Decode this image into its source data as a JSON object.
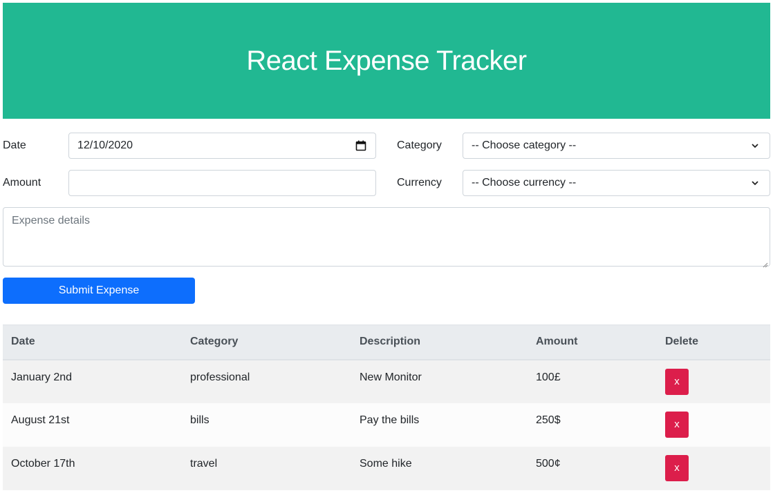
{
  "header": {
    "title": "React Expense Tracker"
  },
  "form": {
    "date_label": "Date",
    "date_value": "12/10/2020",
    "amount_label": "Amount",
    "amount_value": "",
    "category_label": "Category",
    "category_selected": "-- Choose category --",
    "currency_label": "Currency",
    "currency_selected": "-- Choose currency --",
    "details_placeholder": "Expense details",
    "submit_label": "Submit Expense"
  },
  "table": {
    "headers": [
      "Date",
      "Category",
      "Description",
      "Amount",
      "Delete"
    ],
    "rows": [
      {
        "date": "January 2nd",
        "category": "professional",
        "description": "New Monitor",
        "amount": "100£",
        "delete": "x"
      },
      {
        "date": "August 21st",
        "category": "bills",
        "description": "Pay the bills",
        "amount": "250$",
        "delete": "x"
      },
      {
        "date": "October 17th",
        "category": "travel",
        "description": "Some hike",
        "amount": "500¢",
        "delete": "x"
      }
    ]
  },
  "colors": {
    "header_bg": "#21b892",
    "primary": "#0d6efd",
    "danger": "#dc1e4b",
    "table_header_bg": "#e9ecef"
  },
  "icons": [
    "calendar-icon",
    "chevron-down-icon",
    "resize-grip-icon"
  ]
}
